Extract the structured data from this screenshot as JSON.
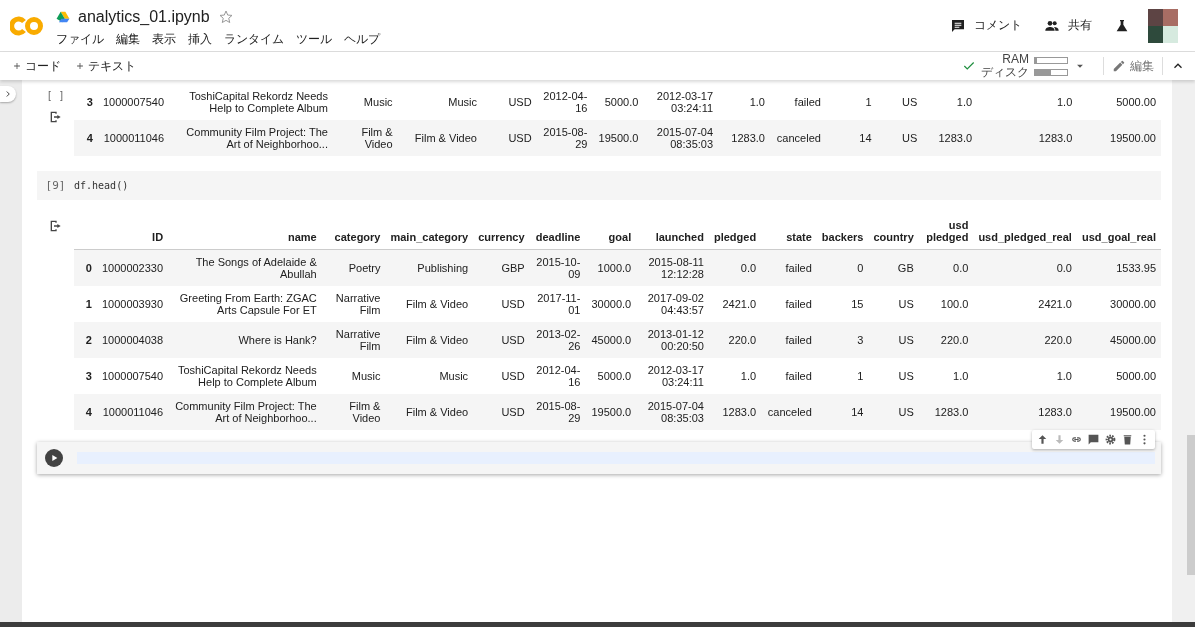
{
  "header": {
    "title": "analytics_01.ipynb",
    "starred": false,
    "menu": [
      "ファイル",
      "編集",
      "表示",
      "挿入",
      "ランタイム",
      "ツール",
      "ヘルプ"
    ],
    "actions": [
      {
        "kind": "comment",
        "label": "コメント"
      },
      {
        "kind": "share",
        "label": "共有"
      }
    ]
  },
  "toolbar": {
    "add_buttons": [
      "コード",
      "テキスト"
    ],
    "ram_label": "RAM",
    "disk_label": "ディスク",
    "ram": {
      "level": 0.06
    },
    "disk": {
      "level": 0.5
    },
    "edit_label": "編集"
  },
  "previous_output": {
    "execution_count": "[ ]",
    "rows": [
      [
        "3",
        "1000007540",
        "ToshiCapital Rekordz Needs Help to Complete Album",
        "Music",
        "Music",
        "USD",
        "2012-04-16",
        "5000.0",
        "2012-03-17 03:24:11",
        "1.0",
        "failed",
        "1",
        "US",
        "1.0",
        "1.0",
        "5000.00"
      ],
      [
        "4",
        "1000011046",
        "Community Film Project: The Art of Neighborhoo...",
        "Film & Video",
        "Film & Video",
        "USD",
        "2015-08-29",
        "19500.0",
        "2015-07-04 08:35:03",
        "1283.0",
        "canceled",
        "14",
        "US",
        "1283.0",
        "1283.0",
        "19500.00"
      ]
    ]
  },
  "code_cell": {
    "execution_count": "[9]",
    "code": "df.head()"
  },
  "output": {
    "columns": [
      "",
      "ID",
      "name",
      "category",
      "main_category",
      "currency",
      "deadline",
      "goal",
      "launched",
      "pledged",
      "state",
      "backers",
      "country",
      "usd pledged",
      "usd_pledged_real",
      "usd_goal_real"
    ],
    "rows": [
      [
        "0",
        "1000002330",
        "The Songs of Adelaide & Abullah",
        "Poetry",
        "Publishing",
        "GBP",
        "2015-10-09",
        "1000.0",
        "2015-08-11 12:12:28",
        "0.0",
        "failed",
        "0",
        "GB",
        "0.0",
        "0.0",
        "1533.95"
      ],
      [
        "1",
        "1000003930",
        "Greeting From Earth: ZGAC Arts Capsule For ET",
        "Narrative Film",
        "Film & Video",
        "USD",
        "2017-11-01",
        "30000.0",
        "2017-09-02 04:43:57",
        "2421.0",
        "failed",
        "15",
        "US",
        "100.0",
        "2421.0",
        "30000.00"
      ],
      [
        "2",
        "1000004038",
        "Where is Hank?",
        "Narrative Film",
        "Film & Video",
        "USD",
        "2013-02-26",
        "45000.0",
        "2013-01-12 00:20:50",
        "220.0",
        "failed",
        "3",
        "US",
        "220.0",
        "220.0",
        "45000.00"
      ],
      [
        "3",
        "1000007540",
        "ToshiCapital Rekordz Needs Help to Complete Album",
        "Music",
        "Music",
        "USD",
        "2012-04-16",
        "5000.0",
        "2012-03-17 03:24:11",
        "1.0",
        "failed",
        "1",
        "US",
        "1.0",
        "1.0",
        "5000.00"
      ],
      [
        "4",
        "1000011046",
        "Community Film Project: The Art of Neighborhoo...",
        "Film & Video",
        "Film & Video",
        "USD",
        "2015-08-29",
        "19500.0",
        "2015-07-04 08:35:03",
        "1283.0",
        "canceled",
        "14",
        "US",
        "1283.0",
        "1283.0",
        "19500.00"
      ]
    ]
  }
}
